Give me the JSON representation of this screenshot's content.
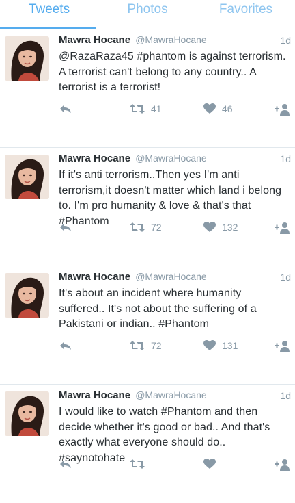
{
  "tabs": [
    {
      "label": "Tweets",
      "active": true
    },
    {
      "label": "Photos",
      "active": false
    },
    {
      "label": "Favorites",
      "active": false
    }
  ],
  "colors": {
    "accent": "#55acee",
    "meta": "#8899a6",
    "text": "#292f33"
  },
  "tweets": [
    {
      "name": "Mawra Hocane",
      "handle": "@MawraHocane",
      "time": "1d",
      "text": "@RazaRaza45 #phantom is against terrorism. A terrorist can't belong to any country.. A terrorist is a terrorist!",
      "retweets": "41",
      "favorites": "46"
    },
    {
      "name": "Mawra Hocane",
      "handle": "@MawraHocane",
      "time": "1d",
      "text": "If it's anti terrorism..Then yes I'm anti terrorism,it doesn't matter which land i belong to. I'm pro humanity & love & that's that #Phantom",
      "retweets": "72",
      "favorites": "132"
    },
    {
      "name": "Mawra Hocane",
      "handle": "@MawraHocane",
      "time": "1d",
      "text": "It's about an incident where humanity suffered.. It's not about the suffering of a Pakistani or indian.. #Phantom",
      "retweets": "72",
      "favorites": "131"
    },
    {
      "name": "Mawra Hocane",
      "handle": "@MawraHocane",
      "time": "1d",
      "text": "I would like to watch #Phantom and then decide whether it's good or bad.. And that's exactly what everyone should do.. #saynotohate",
      "retweets": "",
      "favorites": ""
    }
  ]
}
